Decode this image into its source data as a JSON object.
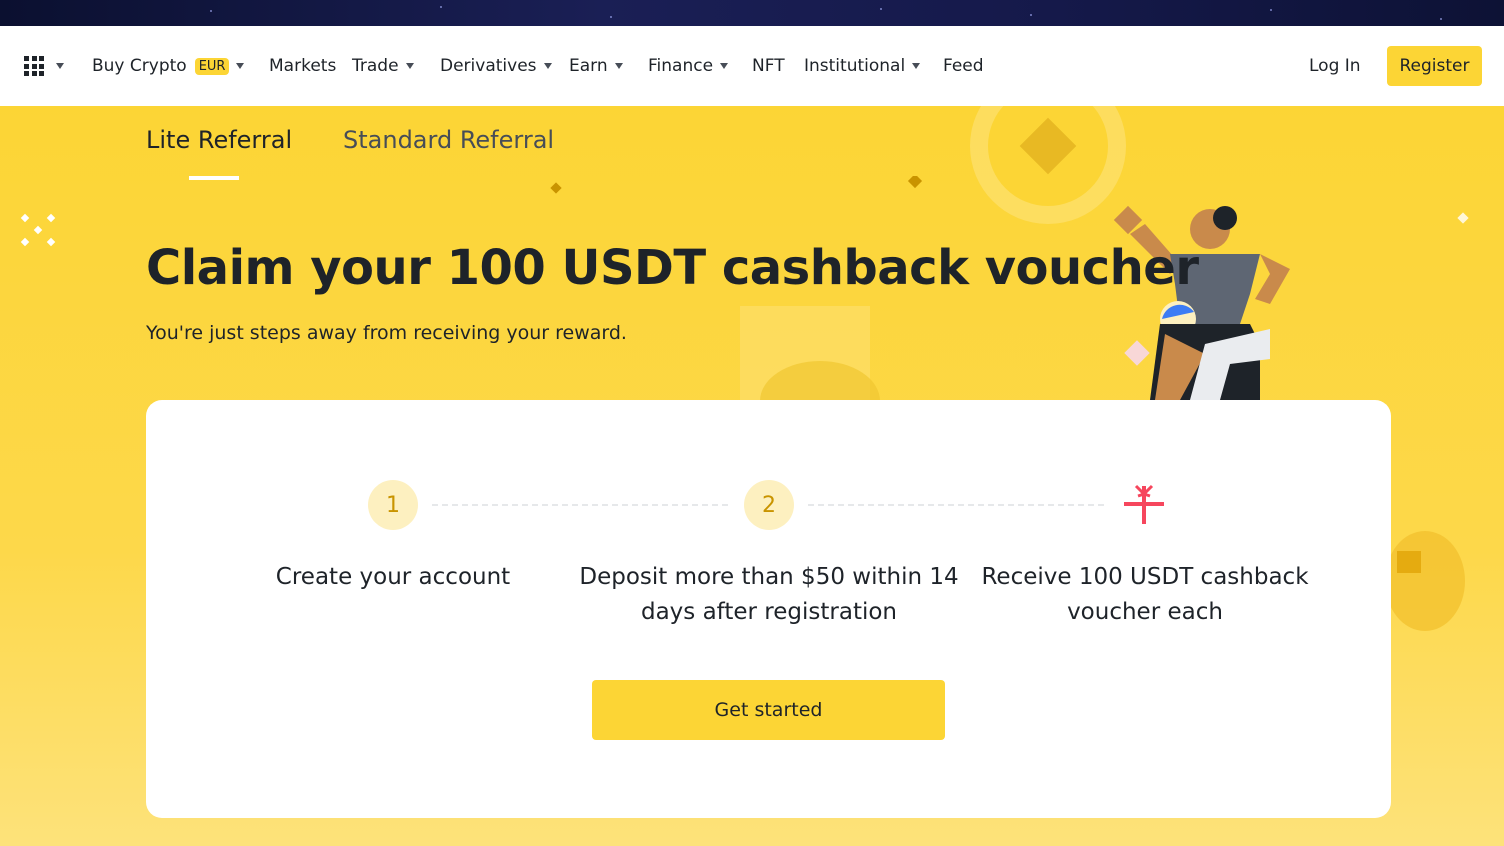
{
  "nav": {
    "menu_icon": "grid-icon",
    "items": [
      {
        "label": "Buy Crypto",
        "badge": "EUR",
        "dropdown": true
      },
      {
        "label": "Markets",
        "dropdown": false
      },
      {
        "label": "Trade",
        "dropdown": true
      },
      {
        "label": "Derivatives",
        "dropdown": true
      },
      {
        "label": "Earn",
        "dropdown": true
      },
      {
        "label": "Finance",
        "dropdown": true
      },
      {
        "label": "NFT",
        "dropdown": false
      },
      {
        "label": "Institutional",
        "dropdown": true
      },
      {
        "label": "Feed",
        "dropdown": false
      }
    ],
    "login_label": "Log In",
    "register_label": "Register"
  },
  "tabs": [
    {
      "label": "Lite Referral",
      "active": true
    },
    {
      "label": "Standard Referral",
      "active": false
    }
  ],
  "hero": {
    "title": "Claim your 100 USDT cashback voucher",
    "subtitle": "You're just steps away from receiving your reward."
  },
  "steps": [
    {
      "number": "1",
      "text": "Create your account"
    },
    {
      "number": "2",
      "text": "Deposit more than $50 within 14 days after registration"
    },
    {
      "icon": "gift-icon",
      "text": "Receive 100 USDT cashback voucher each"
    }
  ],
  "cta_label": "Get started",
  "colors": {
    "brand_yellow": "#fcd535",
    "text_dark": "#1e2329",
    "step_circle_bg": "#fdf0c0",
    "step_number": "#c99400",
    "gift_red": "#f6465d"
  }
}
